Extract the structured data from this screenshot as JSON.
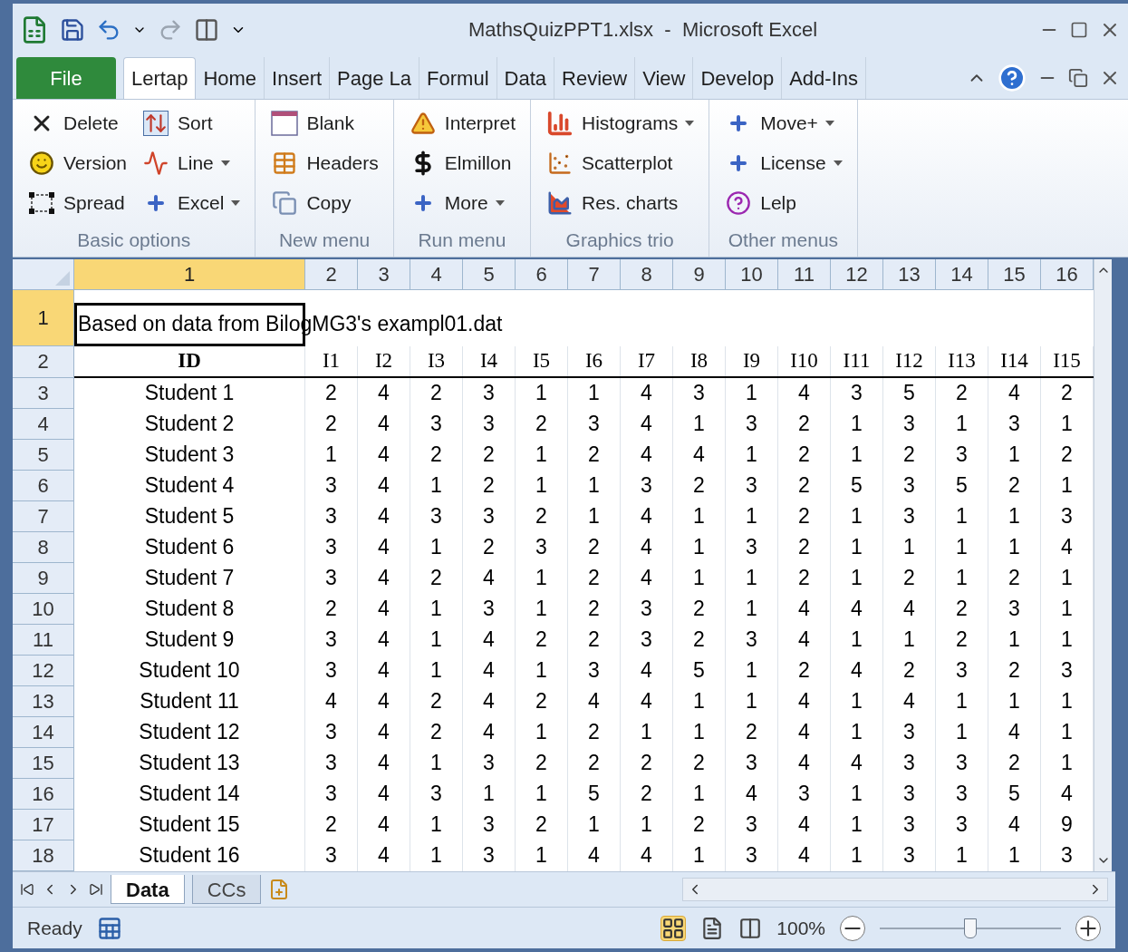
{
  "window": {
    "title": "MathsQuizPPT1.xlsx  -  Microsoft Excel"
  },
  "ribbon_tabs": [
    {
      "label": "File",
      "kind": "file",
      "selected": false
    },
    {
      "label": "Lertap",
      "kind": "tab",
      "selected": true
    },
    {
      "label": "Home",
      "kind": "tab",
      "selected": false
    },
    {
      "label": "Insert",
      "kind": "tab",
      "selected": false
    },
    {
      "label": "Page La",
      "kind": "tab",
      "selected": false
    },
    {
      "label": "Formul",
      "kind": "tab",
      "selected": false
    },
    {
      "label": "Data",
      "kind": "tab",
      "selected": false
    },
    {
      "label": "Review",
      "kind": "tab",
      "selected": false
    },
    {
      "label": "View",
      "kind": "tab",
      "selected": false
    },
    {
      "label": "Develop",
      "kind": "tab",
      "selected": false
    },
    {
      "label": "Add-Ins",
      "kind": "tab",
      "selected": false
    }
  ],
  "ribbon_groups": [
    {
      "label": "Basic options",
      "items": [
        {
          "label": "Delete",
          "dropdown": false
        },
        {
          "label": "Version",
          "dropdown": false
        },
        {
          "label": "Spread",
          "dropdown": false
        },
        {
          "label": "Sort",
          "dropdown": false
        },
        {
          "label": "Line",
          "dropdown": true
        },
        {
          "label": "Excel",
          "dropdown": true
        }
      ]
    },
    {
      "label": "New menu",
      "items": [
        {
          "label": "Blank",
          "dropdown": false
        },
        {
          "label": "Headers",
          "dropdown": false
        },
        {
          "label": "Copy",
          "dropdown": false
        }
      ]
    },
    {
      "label": "Run menu",
      "items": [
        {
          "label": "Interpret",
          "dropdown": false
        },
        {
          "label": "Elmillon",
          "dropdown": false
        },
        {
          "label": "More",
          "dropdown": true
        }
      ]
    },
    {
      "label": "Graphics trio",
      "items": [
        {
          "label": "Histograms",
          "dropdown": true
        },
        {
          "label": "Scatterplot",
          "dropdown": false
        },
        {
          "label": "Res. charts",
          "dropdown": false
        }
      ]
    },
    {
      "label": "Other menus",
      "items": [
        {
          "label": "Move+",
          "dropdown": true
        },
        {
          "label": "License",
          "dropdown": true
        },
        {
          "label": "Lelp",
          "dropdown": false
        }
      ]
    }
  ],
  "sheet": {
    "column_headers": [
      {
        "label": "1",
        "selected": true
      },
      {
        "label": "2",
        "selected": false
      },
      {
        "label": "3",
        "selected": false
      },
      {
        "label": "4",
        "selected": false
      },
      {
        "label": "5",
        "selected": false
      },
      {
        "label": "6",
        "selected": false
      },
      {
        "label": "7",
        "selected": false
      },
      {
        "label": "8",
        "selected": false
      },
      {
        "label": "9",
        "selected": false
      },
      {
        "label": "10",
        "selected": false
      },
      {
        "label": "11",
        "selected": false
      },
      {
        "label": "12",
        "selected": false
      },
      {
        "label": "13",
        "selected": false
      },
      {
        "label": "14",
        "selected": false
      },
      {
        "label": "15",
        "selected": false
      },
      {
        "label": "16",
        "selected": false
      }
    ],
    "rows": [
      {
        "header": "1",
        "selected": true,
        "kind": "note",
        "text": "Based on data from BilogMG3's exampl01.dat"
      },
      {
        "header": "2",
        "selected": false,
        "kind": "heading",
        "cells": [
          "ID",
          "I1",
          "I2",
          "I3",
          "I4",
          "I5",
          "I6",
          "I7",
          "I8",
          "I9",
          "I10",
          "I11",
          "I12",
          "I13",
          "I14",
          "I15"
        ]
      },
      {
        "header": "3",
        "selected": false,
        "kind": "data",
        "cells": [
          "Student 1",
          "2",
          "4",
          "2",
          "3",
          "1",
          "1",
          "4",
          "3",
          "1",
          "4",
          "3",
          "5",
          "2",
          "4",
          "2"
        ]
      },
      {
        "header": "4",
        "selected": false,
        "kind": "data",
        "cells": [
          "Student 2",
          "2",
          "4",
          "3",
          "3",
          "2",
          "3",
          "4",
          "1",
          "3",
          "2",
          "1",
          "3",
          "1",
          "3",
          "1"
        ]
      },
      {
        "header": "5",
        "selected": false,
        "kind": "data",
        "cells": [
          "Student 3",
          "1",
          "4",
          "2",
          "2",
          "1",
          "2",
          "4",
          "4",
          "1",
          "2",
          "1",
          "2",
          "3",
          "1",
          "2"
        ]
      },
      {
        "header": "6",
        "selected": false,
        "kind": "data",
        "cells": [
          "Student 4",
          "3",
          "4",
          "1",
          "2",
          "1",
          "1",
          "3",
          "2",
          "3",
          "2",
          "5",
          "3",
          "5",
          "2",
          "1"
        ]
      },
      {
        "header": "7",
        "selected": false,
        "kind": "data",
        "cells": [
          "Student 5",
          "3",
          "4",
          "3",
          "3",
          "2",
          "1",
          "4",
          "1",
          "1",
          "2",
          "1",
          "3",
          "1",
          "1",
          "3"
        ]
      },
      {
        "header": "8",
        "selected": false,
        "kind": "data",
        "cells": [
          "Student 6",
          "3",
          "4",
          "1",
          "2",
          "3",
          "2",
          "4",
          "1",
          "3",
          "2",
          "1",
          "1",
          "1",
          "1",
          "4"
        ]
      },
      {
        "header": "9",
        "selected": false,
        "kind": "data",
        "cells": [
          "Student 7",
          "3",
          "4",
          "2",
          "4",
          "1",
          "2",
          "4",
          "1",
          "1",
          "2",
          "1",
          "2",
          "1",
          "2",
          "1"
        ]
      },
      {
        "header": "10",
        "selected": false,
        "kind": "data",
        "cells": [
          "Student 8",
          "2",
          "4",
          "1",
          "3",
          "1",
          "2",
          "3",
          "2",
          "1",
          "4",
          "4",
          "4",
          "2",
          "3",
          "1"
        ]
      },
      {
        "header": "11",
        "selected": false,
        "kind": "data",
        "cells": [
          "Student 9",
          "3",
          "4",
          "1",
          "4",
          "2",
          "2",
          "3",
          "2",
          "3",
          "4",
          "1",
          "1",
          "2",
          "1",
          "1"
        ]
      },
      {
        "header": "12",
        "selected": false,
        "kind": "data",
        "cells": [
          "Student 10",
          "3",
          "4",
          "1",
          "4",
          "1",
          "3",
          "4",
          "5",
          "1",
          "2",
          "4",
          "2",
          "3",
          "2",
          "3"
        ]
      },
      {
        "header": "13",
        "selected": false,
        "kind": "data",
        "cells": [
          "Student 11",
          "4",
          "4",
          "2",
          "4",
          "2",
          "4",
          "4",
          "1",
          "1",
          "4",
          "1",
          "4",
          "1",
          "1",
          "1"
        ]
      },
      {
        "header": "14",
        "selected": false,
        "kind": "data",
        "cells": [
          "Student 12",
          "3",
          "4",
          "2",
          "4",
          "1",
          "2",
          "1",
          "1",
          "2",
          "4",
          "1",
          "3",
          "1",
          "4",
          "1"
        ]
      },
      {
        "header": "15",
        "selected": false,
        "kind": "data",
        "cells": [
          "Student 13",
          "3",
          "4",
          "1",
          "3",
          "2",
          "2",
          "2",
          "2",
          "3",
          "4",
          "4",
          "3",
          "3",
          "2",
          "1"
        ]
      },
      {
        "header": "16",
        "selected": false,
        "kind": "data",
        "cells": [
          "Student 14",
          "3",
          "4",
          "3",
          "1",
          "1",
          "5",
          "2",
          "1",
          "4",
          "3",
          "1",
          "3",
          "3",
          "5",
          "4"
        ]
      },
      {
        "header": "17",
        "selected": false,
        "kind": "data",
        "cells": [
          "Student 15",
          "2",
          "4",
          "1",
          "3",
          "2",
          "1",
          "1",
          "2",
          "3",
          "4",
          "1",
          "3",
          "3",
          "4",
          "9"
        ]
      },
      {
        "header": "18",
        "selected": false,
        "kind": "data",
        "cells": [
          "Student 16",
          "3",
          "4",
          "1",
          "3",
          "1",
          "4",
          "4",
          "1",
          "3",
          "4",
          "1",
          "3",
          "1",
          "1",
          "3"
        ]
      }
    ]
  },
  "sheet_tabs": [
    {
      "label": "Data",
      "selected": true
    },
    {
      "label": "CCs",
      "selected": false
    }
  ],
  "status_bar": {
    "status": "Ready",
    "zoom": "100%",
    "zoom_slider": {
      "level": 0.5
    }
  }
}
